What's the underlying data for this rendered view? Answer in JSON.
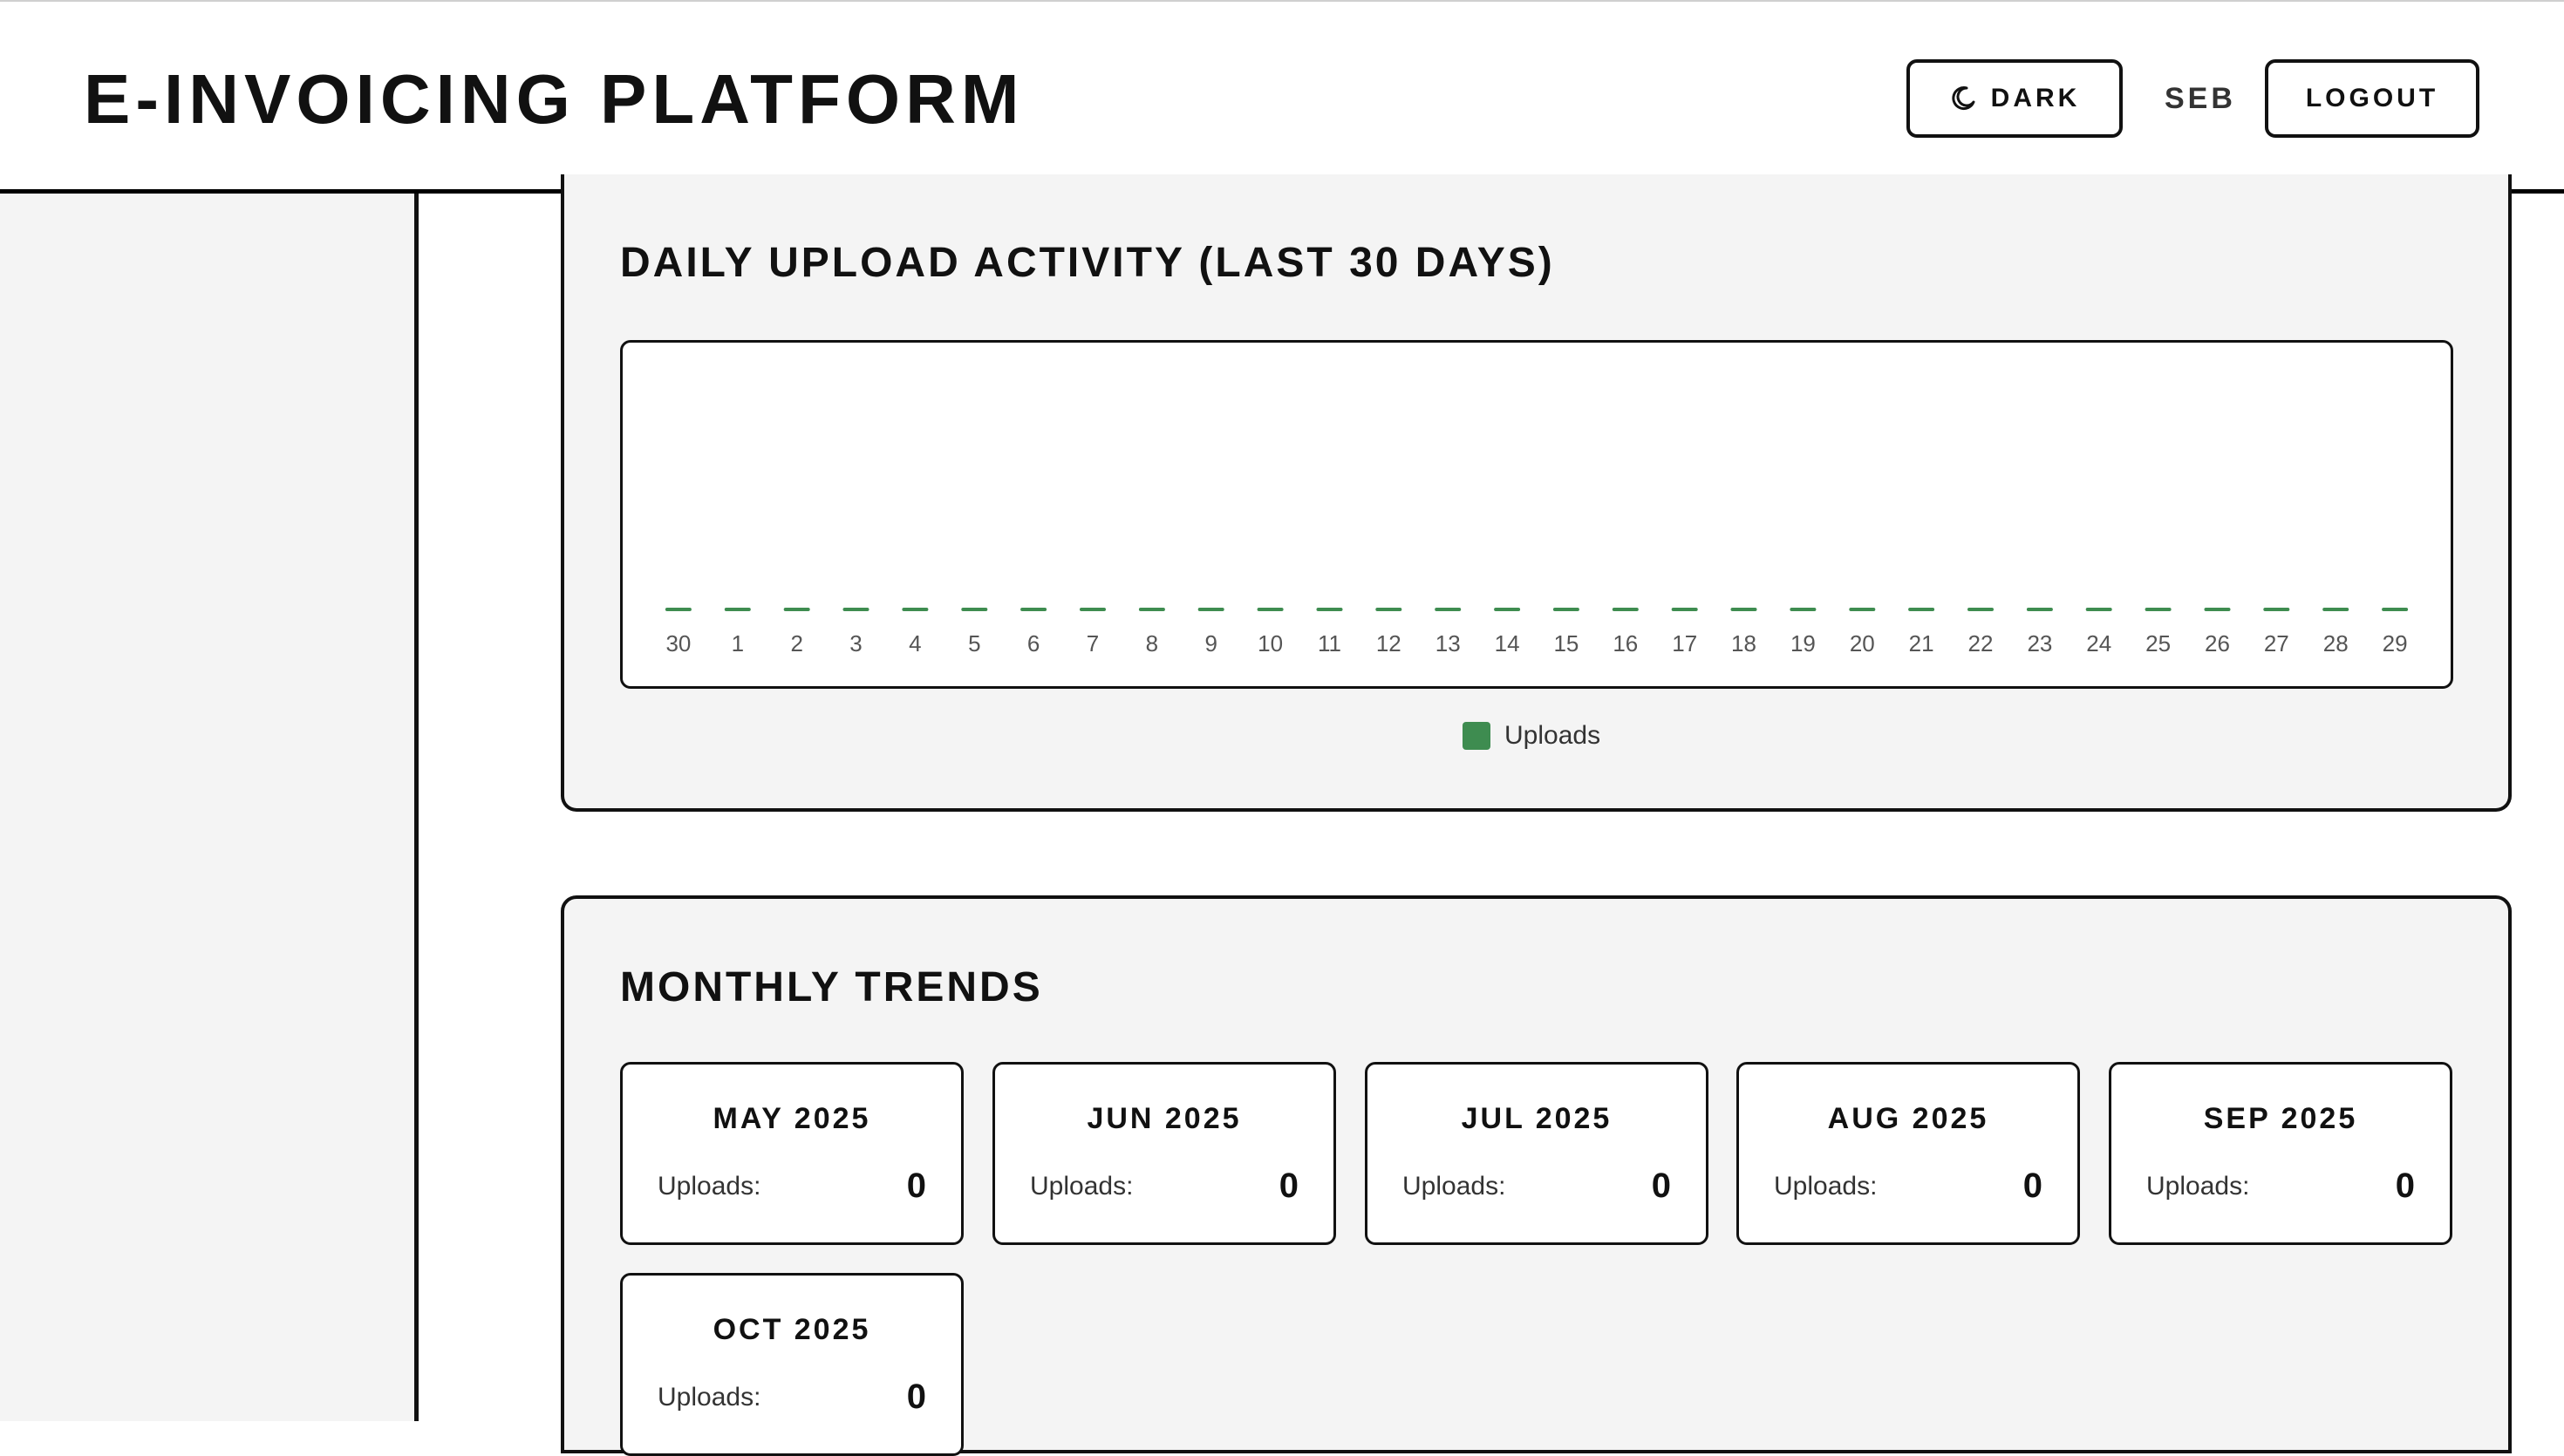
{
  "header": {
    "title": "E-INVOICING PLATFORM",
    "dark_button_label": "DARK",
    "dark_button_icon": "moon-icon",
    "user_name": "SEB",
    "logout_button_label": "LOGOUT"
  },
  "daily_section": {
    "title": "DAILY UPLOAD ACTIVITY (LAST 30 DAYS)",
    "legend_label": "Uploads",
    "accent_color": "#3e8c50"
  },
  "chart_data": {
    "type": "bar",
    "categories": [
      "30",
      "1",
      "2",
      "3",
      "4",
      "5",
      "6",
      "7",
      "8",
      "9",
      "10",
      "11",
      "12",
      "13",
      "14",
      "15",
      "16",
      "17",
      "18",
      "19",
      "20",
      "21",
      "22",
      "23",
      "24",
      "25",
      "26",
      "27",
      "28",
      "29"
    ],
    "series": [
      {
        "name": "Uploads",
        "color": "#3e8c50",
        "values": [
          0,
          0,
          0,
          0,
          0,
          0,
          0,
          0,
          0,
          0,
          0,
          0,
          0,
          0,
          0,
          0,
          0,
          0,
          0,
          0,
          0,
          0,
          0,
          0,
          0,
          0,
          0,
          0,
          0,
          0
        ]
      }
    ],
    "title": "DAILY UPLOAD ACTIVITY (LAST 30 DAYS)",
    "xlabel": "",
    "ylabel": "",
    "grid": false,
    "legend_position": "bottom-center"
  },
  "monthly_section": {
    "title": "MONTHLY TRENDS",
    "uploads_label": "Uploads:",
    "months": [
      {
        "label": "MAY 2025",
        "uploads": "0"
      },
      {
        "label": "JUN 2025",
        "uploads": "0"
      },
      {
        "label": "JUL 2025",
        "uploads": "0"
      },
      {
        "label": "AUG 2025",
        "uploads": "0"
      },
      {
        "label": "SEP 2025",
        "uploads": "0"
      },
      {
        "label": "OCT 2025",
        "uploads": "0"
      }
    ]
  }
}
